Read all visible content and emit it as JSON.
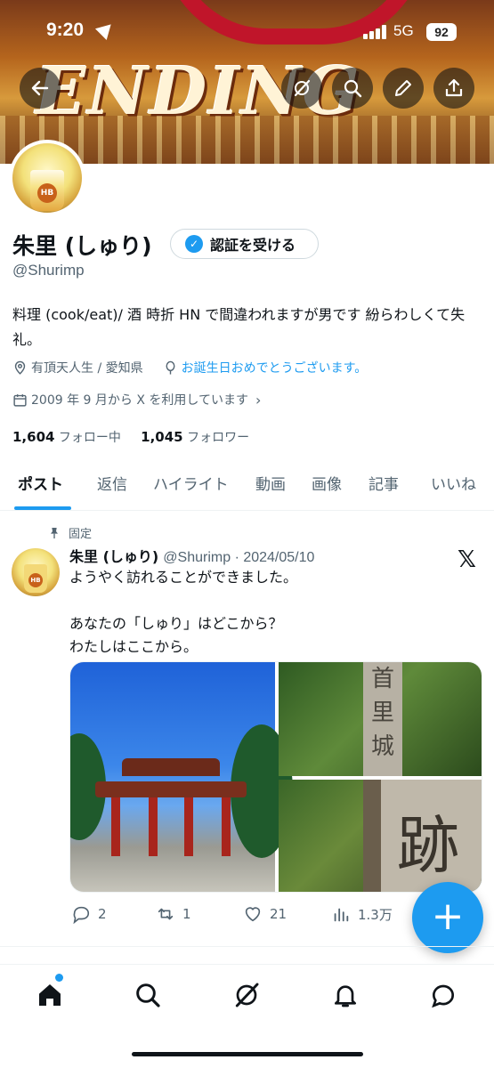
{
  "status_bar": {
    "time": "9:20",
    "network": "5G",
    "battery": "92"
  },
  "profile": {
    "name": "朱里 (しゅり)",
    "verify_label": "認証を受ける",
    "handle": "@Shurimp",
    "bio": "料理 (cook/eat)/ 酒 時折 HN で間違われますが男です 紛らわしくて失礼。",
    "location": "有頂天人生 / 愛知県",
    "link_text": "お誕生日おめでとうございます。",
    "joined": "2009 年 9 月から X を利用しています",
    "following_count": "1,604",
    "following_label": "フォロー中",
    "followers_count": "1,045",
    "followers_label": "フォロワー"
  },
  "tabs": [
    "ポスト",
    "返信",
    "ハイライト",
    "動画",
    "画像",
    "記事",
    "いいね"
  ],
  "pinned_post": {
    "pinned_label": "固定",
    "author": "朱里 (しゅり)",
    "handle_date": "@Shurimp · 2024/05/10",
    "text": "ようやく訪れることができました。\n\nあなたの「しゅり」はどこから？\nわたしはここから。",
    "replies": "2",
    "reposts": "1",
    "likes": "21",
    "views": "1.3万"
  },
  "icons": {
    "back": "arrow-left-icon",
    "grok": "grok-icon",
    "search": "search-icon",
    "edit": "pencil-icon",
    "share": "share-icon",
    "location": "location-pin-icon",
    "balloon": "balloon-icon",
    "calendar": "calendar-icon"
  },
  "colors": {
    "accent": "#1d9bf0",
    "text": "#0f1419",
    "muted": "#536471"
  }
}
